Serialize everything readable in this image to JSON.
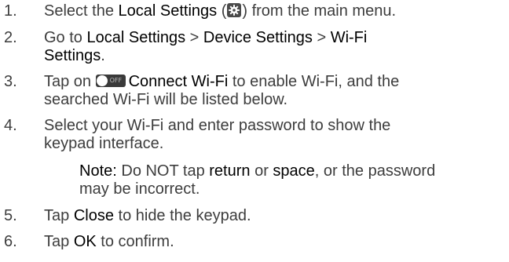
{
  "steps": [
    {
      "num": "1.",
      "pre": "Select the ",
      "b1": "Local Settings",
      "mid": " (",
      "icon": "gear-icon",
      "post": ") from the main menu."
    },
    {
      "num": "2.",
      "pre": "Go to ",
      "b1": "Local Settings",
      "sep1": " > ",
      "b2": "Device Settings",
      "sep2": " > ",
      "b3a": "Wi-Fi",
      "b3b": "Settings",
      "end": "."
    },
    {
      "num": "3.",
      "pre": "Tap on ",
      "toggle_text": "OFF",
      "b1": "Connect Wi-Fi",
      "post1": " to enable Wi-Fi, and the",
      "post2": "searched Wi-Fi will be listed below."
    },
    {
      "num": "4.",
      "line1": "Select your Wi-Fi and enter password to show the",
      "line2": "keypad interface."
    },
    {
      "num": "5.",
      "pre": "Tap ",
      "b1": "Close",
      "post": " to hide the keypad."
    },
    {
      "num": "6.",
      "pre": "Tap ",
      "b1": "OK",
      "post": " to confirm."
    }
  ],
  "note": {
    "label": "Note:",
    "t1": " Do NOT tap ",
    "b1": "return",
    "t2": " or ",
    "b2": "space",
    "t3": ", or the password",
    "line2": "may be incorrect."
  },
  "colors": {
    "text": "#3d3d3d",
    "bold": "#000000",
    "icon_bg": "#4a4a4a",
    "toggle_bg": "#3a3a3a"
  }
}
